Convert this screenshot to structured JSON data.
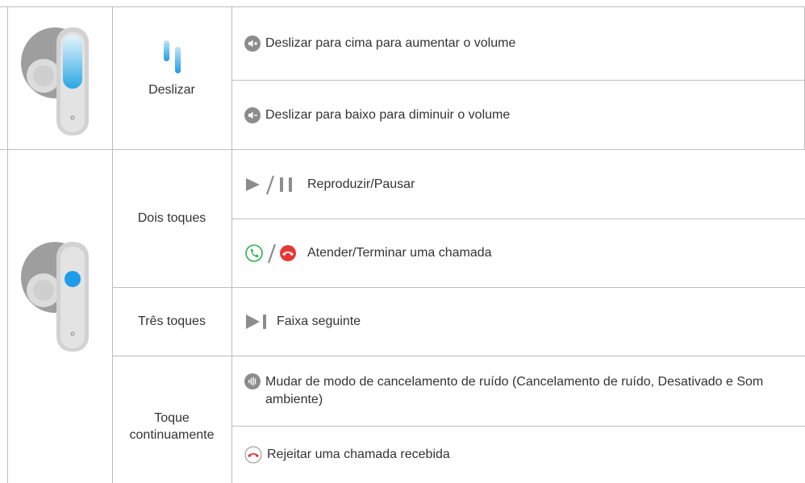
{
  "rows": {
    "slide": {
      "label": "Deslizar",
      "actions": [
        {
          "icon": "volume-up-icon",
          "text": "Deslizar para cima para aumentar o volume"
        },
        {
          "icon": "volume-down-icon",
          "text": "Deslizar para baixo para diminuir o volume"
        }
      ]
    },
    "double_tap": {
      "label": "Dois toques",
      "actions": [
        {
          "icon": "play-pause-icon",
          "text": "Reproduzir/Pausar"
        },
        {
          "icon": "answer-end-call-icon",
          "text": "Atender/Terminar uma chamada"
        }
      ]
    },
    "triple_tap": {
      "label": "Três toques",
      "actions": [
        {
          "icon": "next-track-icon",
          "text": "Faixa seguinte"
        }
      ]
    },
    "long_press": {
      "label": "Toque continuamente",
      "actions": [
        {
          "icon": "noise-mode-icon",
          "text": "Mudar de modo de cancelamento de ruído (Cancelamento de ruído, Desativado e Som ambiente)"
        },
        {
          "icon": "reject-call-icon",
          "text": "Rejeitar uma chamada recebida"
        }
      ]
    }
  },
  "colors": {
    "border": "#bdbdbd",
    "icon_grey": "#8c8c8c",
    "call_green": "#2eaf4b",
    "call_red": "#e53935",
    "touch_blue": "#1e9be9",
    "slide_gradient_top": "#e3f3fc",
    "slide_gradient_bottom": "#2aa7e3"
  }
}
